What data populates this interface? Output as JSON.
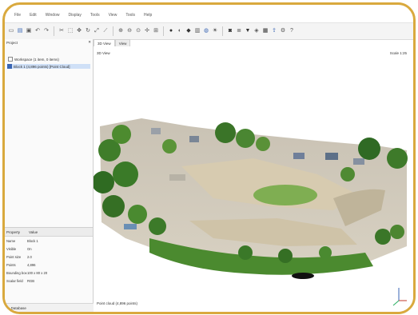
{
  "menu": [
    "File",
    "Edit",
    "Window",
    "Display",
    "Tools",
    "View",
    "Tools",
    "Help"
  ],
  "toolbar_icons": [
    "new-icon",
    "open-icon",
    "save-icon",
    "undo-icon",
    "redo-icon",
    "cut-icon",
    "select-icon",
    "move-icon",
    "rotate-icon",
    "scale-icon",
    "measure-icon",
    "zoom-in-icon",
    "zoom-out-icon",
    "zoom-fit-icon",
    "pan-icon",
    "grid-icon",
    "point-size-icon",
    "segment-icon",
    "clip-icon",
    "section-icon",
    "color-icon",
    "light-icon",
    "camera-icon",
    "layers-icon",
    "filter-icon",
    "classify-icon",
    "mesh-icon",
    "export-icon",
    "settings-icon",
    "help-icon"
  ],
  "left_panel": {
    "title": "Project",
    "tree": [
      {
        "label": "Workspace (1 item, 0 items)",
        "checked": false,
        "selected": false
      },
      {
        "label": "Block 1 (4,896 points) [Point Cloud]",
        "checked": true,
        "selected": true
      }
    ]
  },
  "properties": {
    "col_property": "Property",
    "col_value": "Value",
    "rows": [
      {
        "k": "Name",
        "v": "Block 1"
      },
      {
        "k": "Visible",
        "v": "On"
      },
      {
        "k": "Point size",
        "v": "2.0"
      },
      {
        "k": "Points",
        "v": "4,896"
      },
      {
        "k": "Bounding box",
        "v": "100 x 80 x 20"
      },
      {
        "k": "Scalar field",
        "v": "RGB"
      }
    ],
    "footer": "Database"
  },
  "tabs": [
    "3D View",
    "View"
  ],
  "viewport": {
    "label_left": "3D View",
    "label_right": "Scale 1:25",
    "footer": "Point cloud (4,896 points)"
  },
  "colors": {
    "frame": "#d9a93e",
    "selection": "#cfe0f7",
    "accent": "#3a66b4"
  }
}
